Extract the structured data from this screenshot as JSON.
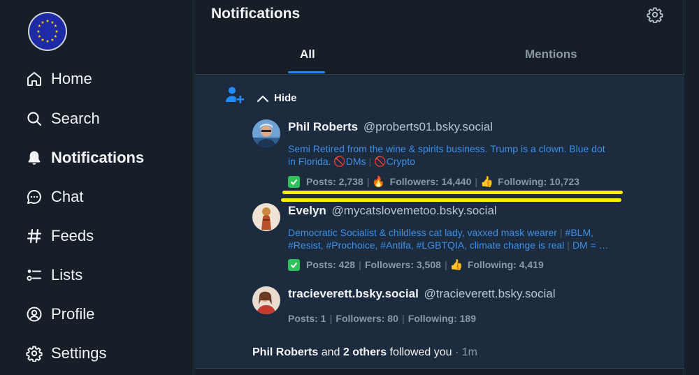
{
  "sidebar": {
    "items": [
      {
        "label": "Home",
        "icon": "home-icon"
      },
      {
        "label": "Search",
        "icon": "search-icon"
      },
      {
        "label": "Notifications",
        "icon": "bell-icon",
        "active": true
      },
      {
        "label": "Chat",
        "icon": "chat-bubble-icon"
      },
      {
        "label": "Feeds",
        "icon": "hash-icon"
      },
      {
        "label": "Lists",
        "icon": "list-icon"
      },
      {
        "label": "Profile",
        "icon": "profile-icon"
      },
      {
        "label": "Settings",
        "icon": "gear-icon"
      }
    ]
  },
  "header": {
    "title": "Notifications"
  },
  "tabs": [
    {
      "label": "All",
      "selected": true
    },
    {
      "label": "Mentions",
      "selected": false
    }
  ],
  "notification": {
    "hide_label": "Hide",
    "users": [
      {
        "name": "Phil Roberts",
        "handle": "@proberts01.bsky.social",
        "bio_line1": "Semi Retired from the wine & spirits business. Trump is a clown. Blue dot",
        "bio_line2_text": "in Florida.",
        "bio_tag1": "DMs",
        "bio_tag2": "Crypto",
        "posts": "Posts: 2,738",
        "followers": "Followers: 14,440",
        "following": "Following: 10,723"
      },
      {
        "name": "Evelyn",
        "handle": "@mycatslovemetoo.bsky.social",
        "bio_line1a": "Democratic Socialist & childless cat lady, vaxxed mask wearer",
        "bio_line1b": "#BLM,",
        "bio_line2a": "#Resist, #Prochoice, #Antifa, #LGBTQIA, climate change is real",
        "bio_line2b": "DM = …",
        "posts": "Posts: 428",
        "followers": "Followers: 3,508",
        "following": "Following: 4,419"
      },
      {
        "name": "tracieverett.bsky.social",
        "handle": "@tracieverett.bsky.social",
        "posts": "Posts: 1",
        "followers": "Followers: 80",
        "following": "Following: 189"
      }
    ],
    "summary": {
      "actor": "Phil Roberts",
      "and": "and",
      "others": "2 others",
      "action": "followed you",
      "time": "· 1m"
    }
  },
  "colors": {
    "background": "#161e27",
    "panel": "#1c2b3d",
    "accent": "#208bfe",
    "bio_link": "#3e8fe6",
    "highlight": "#ffee00",
    "verified_check": "#2fc25b"
  }
}
